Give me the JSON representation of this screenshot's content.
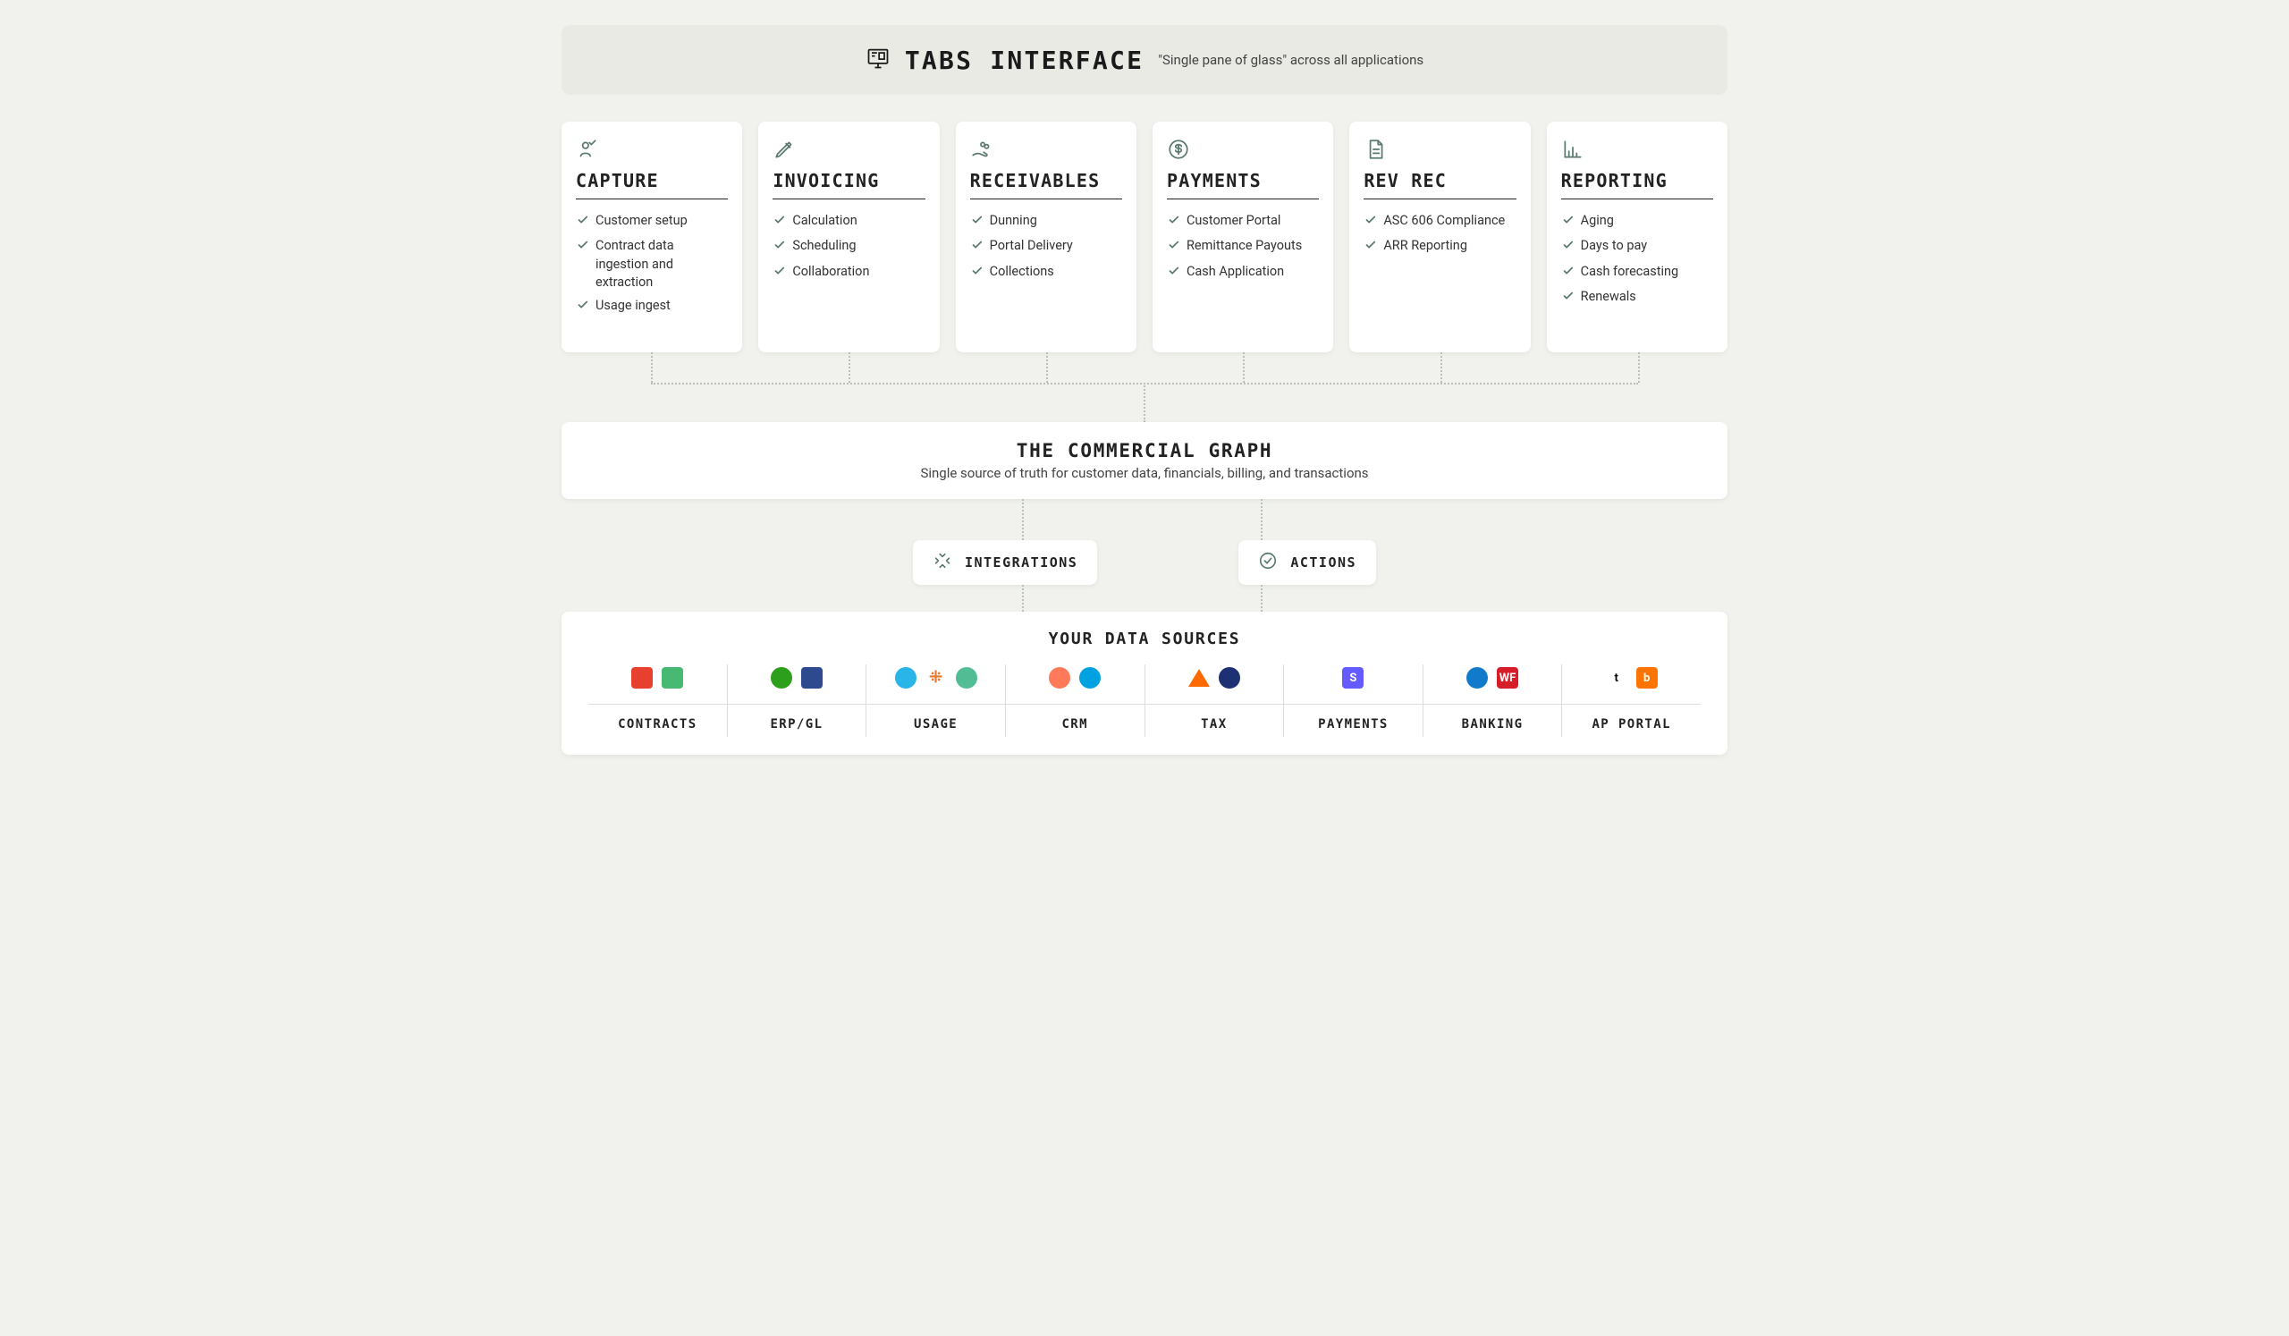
{
  "header": {
    "title": "TABS INTERFACE",
    "subtitle": "\"Single pane of glass\" across all applications"
  },
  "cards": [
    {
      "id": "capture",
      "title": "CAPTURE",
      "icon": "person-check-icon",
      "items": [
        "Customer setup",
        "Contract data ingestion and extraction",
        "Usage ingest"
      ]
    },
    {
      "id": "invoicing",
      "title": "INVOICING",
      "icon": "pencil-icon",
      "items": [
        "Calculation",
        "Scheduling",
        "Collaboration"
      ]
    },
    {
      "id": "receivables",
      "title": "RECEIVABLES",
      "icon": "hand-coins-icon",
      "items": [
        "Dunning",
        "Portal Delivery",
        "Collections"
      ]
    },
    {
      "id": "payments",
      "title": "PAYMENTS",
      "icon": "dollar-circle-icon",
      "items": [
        "Customer Portal",
        "Remittance Payouts",
        "Cash Application"
      ]
    },
    {
      "id": "revrec",
      "title": "REV REC",
      "icon": "document-icon",
      "items": [
        "ASC 606 Compliance",
        "ARR Reporting"
      ]
    },
    {
      "id": "reporting",
      "title": "REPORTING",
      "icon": "bar-chart-icon",
      "items": [
        "Aging",
        "Days to pay",
        "Cash forecasting",
        "Renewals"
      ]
    }
  ],
  "commercial_graph": {
    "title": "THE COMMERCIAL GRAPH",
    "subtitle": "Single source of truth for customer data, financials, billing, and transactions"
  },
  "pills": {
    "integrations": "INTEGRATIONS",
    "actions": "ACTIONS"
  },
  "data_sources": {
    "title": "YOUR DATA SOURCES",
    "columns": [
      {
        "label": "CONTRACTS",
        "logos": [
          {
            "name": "dealhub",
            "bg": "#e7402f"
          },
          {
            "name": "pandadoc",
            "bg": "#47b972"
          }
        ]
      },
      {
        "label": "ERP/GL",
        "logos": [
          {
            "name": "quickbooks",
            "bg": "#2ca01c",
            "shape": "circle"
          },
          {
            "name": "netsuite",
            "bg": "#2e4a8f"
          }
        ]
      },
      {
        "label": "USAGE",
        "logos": [
          {
            "name": "snowflake",
            "bg": "#29b5e8",
            "shape": "circle"
          },
          {
            "name": "tableau",
            "bg": "#e8762d",
            "shape": "dots"
          },
          {
            "name": "segment",
            "bg": "#52bd94",
            "shape": "circle"
          }
        ]
      },
      {
        "label": "CRM",
        "logos": [
          {
            "name": "hubspot",
            "bg": "#ff7a59",
            "shape": "circle"
          },
          {
            "name": "salesforce",
            "bg": "#00a1e0",
            "shape": "circle"
          }
        ]
      },
      {
        "label": "TAX",
        "logos": [
          {
            "name": "avalara",
            "bg": "#ff6a00",
            "shape": "triangle"
          },
          {
            "name": "anrok",
            "bg": "#1d3073",
            "shape": "circle"
          }
        ]
      },
      {
        "label": "PAYMENTS",
        "logos": [
          {
            "name": "stripe",
            "bg": "#635bff",
            "text": "S"
          }
        ]
      },
      {
        "label": "BANKING",
        "logos": [
          {
            "name": "chase",
            "bg": "#117aca",
            "shape": "circle"
          },
          {
            "name": "wellsfargo",
            "bg": "#d71e28",
            "text": "WF"
          }
        ]
      },
      {
        "label": "AP PORTAL",
        "logos": [
          {
            "name": "tipalti",
            "bg": "#ffffff",
            "text": "t",
            "fg": "#000"
          },
          {
            "name": "billcom",
            "bg": "#ff7300",
            "text": "b"
          }
        ]
      }
    ]
  }
}
